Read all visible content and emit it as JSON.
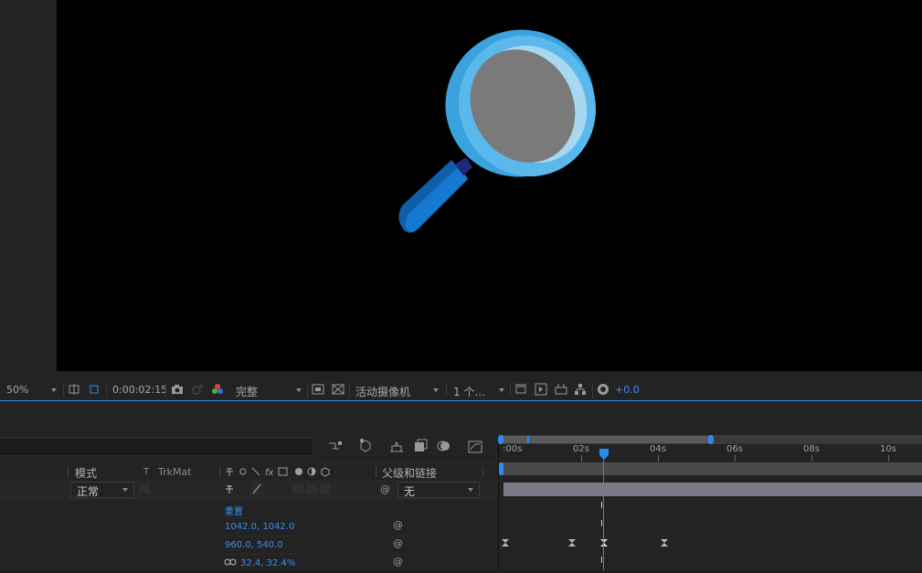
{
  "viewer_toolbar": {
    "zoom": "50%",
    "timecode": "0:00:02:15",
    "resolution": "完整",
    "camera": "活动摄像机",
    "views": "1 个...",
    "exposure": "+0.0"
  },
  "layer_headers": {
    "mode": "模式",
    "t": "T",
    "trkmat": "TrkMat",
    "parent": "父级和链接"
  },
  "layer_row": {
    "mode_value": "正常",
    "parent_value": "无"
  },
  "properties": {
    "reset": "重置",
    "anchor": "1042.0, 1042.0",
    "position": "960.0, 540.0",
    "scale": "32.4, 32.4%"
  },
  "ruler": {
    "labels": [
      ":00s",
      "02s",
      "04s",
      "06s",
      "08s",
      "10s"
    ]
  },
  "colors": {
    "accent": "#2d8ceb",
    "value_blue": "#3a8ef0",
    "lens_rim": "#5ab8ec",
    "lens_glass": "#7a7a7a",
    "handle": "#1778d2"
  },
  "icons": [
    "magnifier-graphic",
    "snapshot-icon",
    "color-channel-icon",
    "pick-whip-icon",
    "composition-icon"
  ]
}
